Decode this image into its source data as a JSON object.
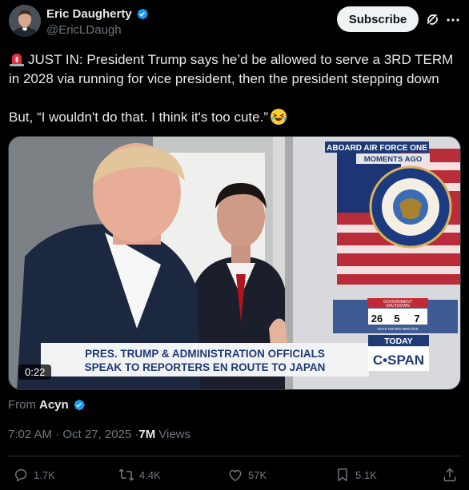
{
  "author": {
    "display_name": "Eric Daugherty",
    "handle": "@EricLDaugh"
  },
  "header": {
    "subscribe_label": "Subscribe"
  },
  "tweet": {
    "line1": "JUST IN: President Trump says he’d be allowed to serve a 3RD TERM in 2028 via running for vice president, then the president stepping down",
    "line2": "But, “I wouldn't do that. I think it's too cute.”"
  },
  "media": {
    "duration": "0:22",
    "overlay_top1": "ABOARD AIR FORCE ONE",
    "overlay_top2": "MOMENTS AGO",
    "chyron_line1": "PRES. TRUMP & ADMINISTRATION OFFICIALS",
    "chyron_line2": "SPEAK TO REPORTERS EN ROUTE TO JAPAN",
    "today_label": "TODAY",
    "network": "C•SPAN",
    "shutdown_label1": "GOVERNMENT",
    "shutdown_label2": "SHUTDOWN",
    "shutdown_days": "26",
    "shutdown_hours": "5",
    "shutdown_minutes": "7",
    "shutdown_units": "DAYS  HOURS  MINUTES"
  },
  "from": {
    "label": "From",
    "name": "Acyn"
  },
  "meta": {
    "time": "7:02 AM · Oct 27, 2025 · ",
    "views_count": "7M",
    "views_label": "Views"
  },
  "actions": {
    "replies": "1.7K",
    "reposts": "4.4K",
    "likes": "57K",
    "bookmarks": "5.1K"
  },
  "colors": {
    "background": "#000000",
    "text": "#e7e9ea",
    "secondary": "#71767b",
    "verified": "#1d9bf0",
    "divider": "#2f3336"
  },
  "icons": [
    "verified-badge-icon",
    "grok-icon",
    "more-icon",
    "siren-emoji",
    "laughing-emoji",
    "reply-icon",
    "repost-icon",
    "like-icon",
    "bookmark-icon",
    "share-icon"
  ]
}
